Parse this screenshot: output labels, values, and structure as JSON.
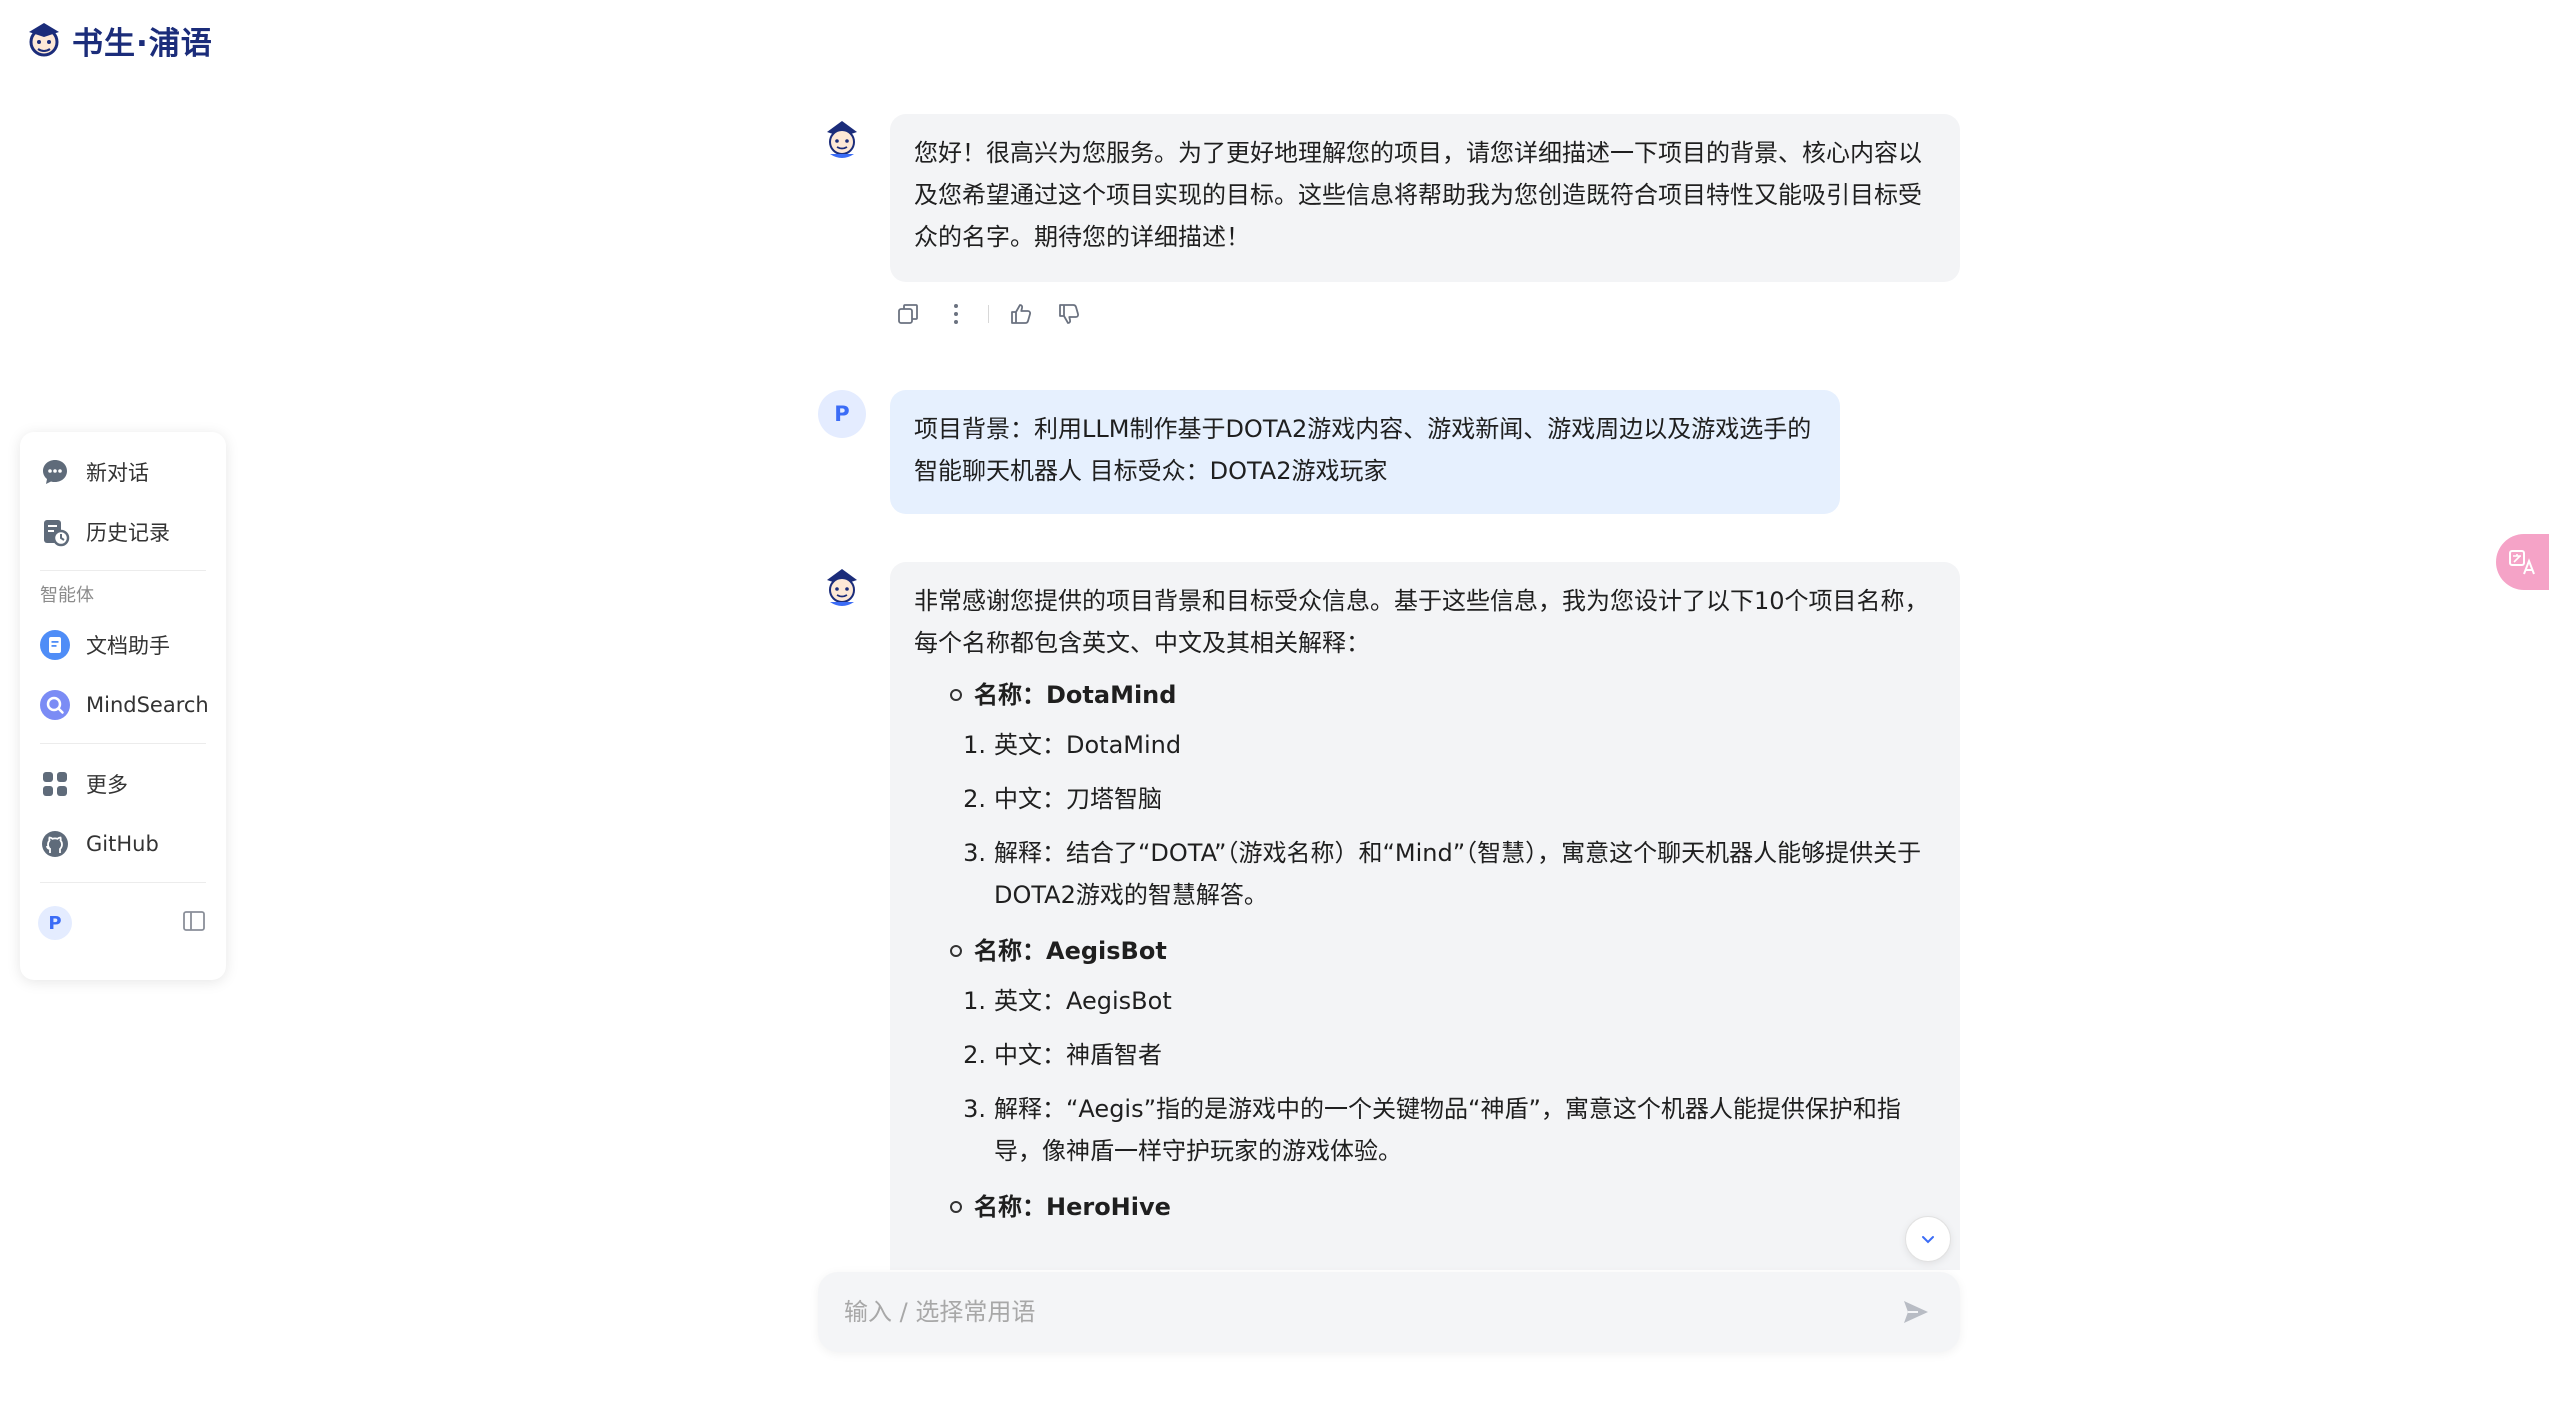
{
  "brand": {
    "name": "书生·浦语"
  },
  "sidebar": {
    "new_chat": "新对话",
    "history": "历史记录",
    "agents_section": "智能体",
    "agents": [
      {
        "label": "文档助手",
        "icon": "document-assistant-icon"
      },
      {
        "label": "MindSearch",
        "icon": "mindsearch-icon"
      }
    ],
    "more": "更多",
    "github": "GitHub",
    "user_initial": "P"
  },
  "chat": {
    "messages": [
      {
        "role": "assistant",
        "text": "您好！很高兴为您服务。为了更好地理解您的项目，请您详细描述一下项目的背景、核心内容以及您希望通过这个项目实现的目标。这些信息将帮助我为您创造既符合项目特性又能吸引目标受众的名字。期待您的详细描述！"
      },
      {
        "role": "user",
        "avatar": "P",
        "text": "项目背景：利用LLM制作基于DOTA2游戏内容、游戏新闻、游戏周边以及游戏选手的智能聊天机器人 目标受众：DOTA2游戏玩家"
      },
      {
        "role": "assistant",
        "intro": "非常感谢您提供的项目背景和目标受众信息。基于这些信息，我为您设计了以下10个项目名称，每个名称都包含英文、中文及其相关解释：",
        "names": [
          {
            "title": "名称：DotaMind",
            "details": [
              {
                "num": "1.",
                "text": "英文：DotaMind"
              },
              {
                "num": "2.",
                "text": "中文：刀塔智脑"
              },
              {
                "num": "3.",
                "text": "解释：结合了“DOTA”（游戏名称）和“Mind”（智慧），寓意这个聊天机器人能够提供关于DOTA2游戏的智慧解答。"
              }
            ]
          },
          {
            "title": "名称：AegisBot",
            "details": [
              {
                "num": "1.",
                "text": "英文：AegisBot"
              },
              {
                "num": "2.",
                "text": "中文：神盾智者"
              },
              {
                "num": "3.",
                "text": "解释：“Aegis”指的是游戏中的一个关键物品“神盾”，寓意这个机器人能提供保护和指导，像神盾一样守护玩家的游戏体验。"
              }
            ]
          },
          {
            "title": "名称：HeroHive",
            "details": []
          }
        ]
      }
    ]
  },
  "input": {
    "placeholder": "输入 / 选择常用语"
  },
  "colors": {
    "accent": "#3b6cf6",
    "user_bubble": "#e6f0fe",
    "bot_bubble": "#f3f4f6",
    "brand": "#1b2c7a"
  }
}
